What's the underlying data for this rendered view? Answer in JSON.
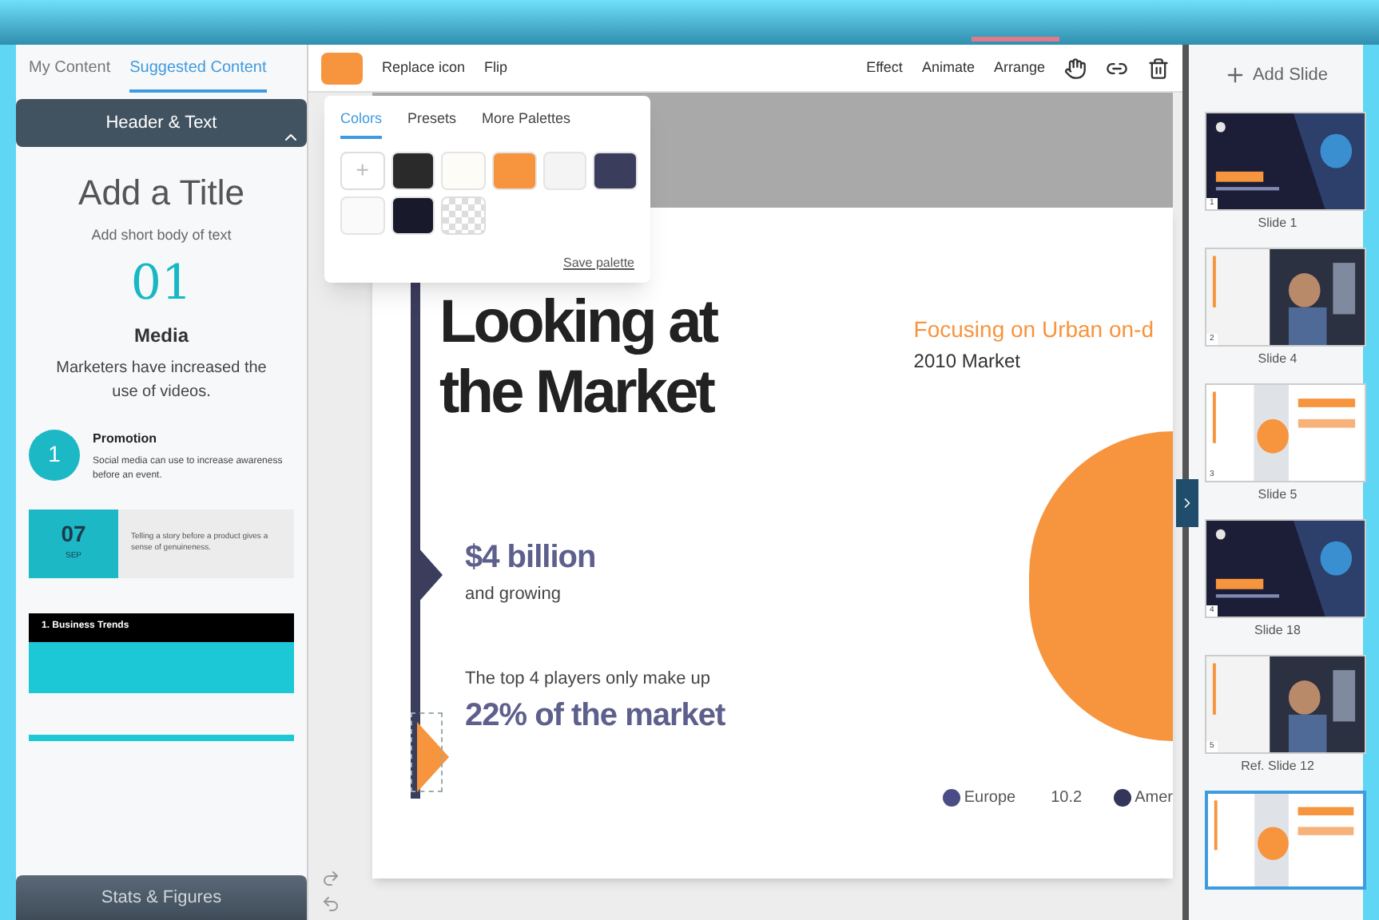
{
  "sidebar": {
    "tabs": [
      {
        "label": "My Content",
        "selected": false
      },
      {
        "label": "Suggested Content",
        "selected": true
      }
    ],
    "sections": [
      {
        "title": "Header & Text",
        "expanded": true
      },
      {
        "title": "Stats & Figures",
        "expanded": false
      }
    ],
    "title_block": {
      "title": "Add a Title",
      "body": "Add short body of text"
    },
    "number_block": {
      "number": "01",
      "title": "Media",
      "body": "Marketers have increased the use of videos."
    },
    "promo_block": {
      "number": "1",
      "title": "Promotion",
      "body": "Social media can use to increase awareness before an event."
    },
    "date_block": {
      "day": "07",
      "month": "SEP",
      "body": "Telling a story before a product gives a sense of genuineness."
    },
    "trend_block": {
      "title": "1. Business Trends"
    }
  },
  "toolbar": {
    "color": "#f7943e",
    "left": [
      "Replace icon",
      "Flip"
    ],
    "right": [
      "Effect",
      "Animate",
      "Arrange"
    ]
  },
  "palette": {
    "tabs": [
      {
        "label": "Colors",
        "selected": true
      },
      {
        "label": "Presets",
        "selected": false
      },
      {
        "label": "More Palettes",
        "selected": false
      }
    ],
    "swatches": [
      {
        "kind": "add",
        "label": "+"
      },
      {
        "kind": "color",
        "color": "#2a2a2a"
      },
      {
        "kind": "color",
        "color": "#fdfcf7"
      },
      {
        "kind": "color",
        "color": "#f7943e"
      },
      {
        "kind": "color",
        "color": "#f4f4f4"
      },
      {
        "kind": "color",
        "color": "#3b3d5c"
      },
      {
        "kind": "color",
        "color": "#fafafa"
      },
      {
        "kind": "color",
        "color": "#181a2c"
      },
      {
        "kind": "transparent"
      }
    ],
    "save": "Save palette"
  },
  "slide": {
    "title": "Looking at the Market",
    "subtitle": "Focusing on Urban on-d",
    "year": "2010 Market",
    "stat1": "$4 billion",
    "stat1_note": "and growing",
    "stat2_note": "The top 4 players only make up",
    "stat2": "22% of the market",
    "legend": [
      {
        "label": "Europe",
        "value": "10.2",
        "color": "#4a4c85"
      },
      {
        "label": "Amer",
        "color": "#33355a"
      }
    ]
  },
  "slides_panel": {
    "add": "Add Slide",
    "slides": [
      {
        "number": "1",
        "label": "Slide 1",
        "kind": "dark",
        "selected": false
      },
      {
        "number": "2",
        "label": "Slide 4",
        "selected": false
      },
      {
        "number": "3",
        "label": "Slide 5",
        "kind": "light",
        "selected": false
      },
      {
        "number": "4",
        "label": "Slide 18",
        "kind": "dark",
        "selected": false
      },
      {
        "number": "5",
        "label": "Ref. Slide 12",
        "selected": false
      },
      {
        "kind": "light",
        "selected": true
      }
    ]
  }
}
